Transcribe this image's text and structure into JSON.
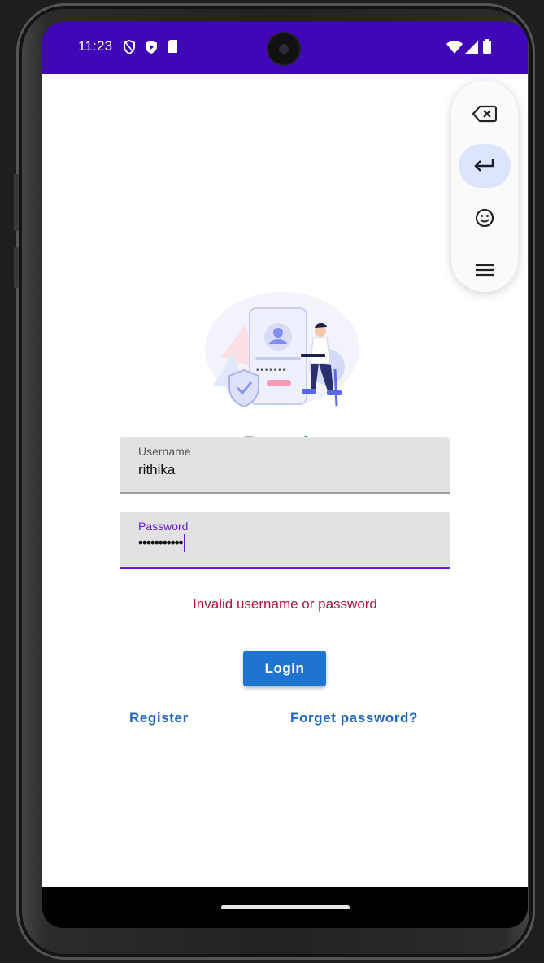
{
  "status_bar": {
    "time": "11:23",
    "icons": [
      "shield-outline-icon",
      "play-protect-icon",
      "sd-card-icon",
      "wifi-icon",
      "signal-icon",
      "battery-icon"
    ]
  },
  "ime_toolbar": {
    "items": [
      "backspace-icon",
      "enter-icon",
      "emoji-icon",
      "menu-icon"
    ]
  },
  "login": {
    "title": "Login",
    "username_label": "Username",
    "username_value": "rithika",
    "password_label": "Password",
    "password_value": "•••••••••••",
    "error_message": "Invalid username or password",
    "login_button": "Login",
    "register_link": "Register",
    "forget_password_link": "Forget password?"
  },
  "colors": {
    "status_bar": "#3f07b8",
    "primary": "#1f73d1",
    "accent": "#6a1bd6",
    "error": "#b0123a"
  }
}
